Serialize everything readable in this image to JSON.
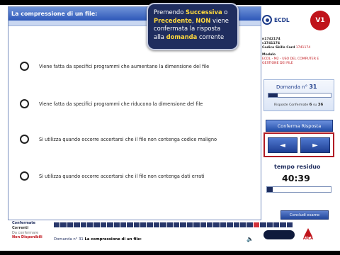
{
  "question": {
    "title": "La compressione di un file:",
    "answers": [
      "Viene fatta da specifici programmi che aumentano la dimensione del file",
      "Viene fatta da specifici programmi che riducono la dimensione del file",
      "Si utilizza quando occorre accertarsi che il file non contenga codice maligno",
      "Si utilizza quando occorre accertarsi che il file non contenga dati errati"
    ]
  },
  "callout": {
    "parts": [
      "Premendo ",
      "Successiva",
      " o ",
      "Precedente",
      ", ",
      "NON",
      " viene confermata la risposta alla ",
      "domanda",
      " corrente"
    ]
  },
  "header": {
    "ecdl_logo": "ECDL",
    "red_logo": "V1"
  },
  "candidate": {
    "id1": "n1742174",
    "id2": "c1741174",
    "skills_card_label": "Codice Skills Card",
    "skills_card_value": "1741174",
    "modulo_label": "Modulo",
    "modulo_value": "ECDL - M2 - USO DEL COMPUTER E GESTIONE DEI FILE"
  },
  "domanda": {
    "label": "Domanda n°",
    "number": "31",
    "progress": 0.15,
    "risposte_label": "Risposte Confermate",
    "risposte_count": "6",
    "risposte_sep": "su",
    "risposte_total": "36"
  },
  "buttons": {
    "conferma": "Conferma Risposta",
    "prev": "◄",
    "next": "►",
    "concludi": "Concludi esame"
  },
  "timer": {
    "label": "tempo residuo",
    "value": "40:39",
    "progress": 0.09
  },
  "legend": {
    "confermate": "Confermate",
    "correnti": "Correnti",
    "da_confermare": "Da confermare",
    "non_disponibili": "Non Disponibili"
  },
  "strip": {
    "total": 36,
    "current": 31,
    "filled_until": 36
  },
  "footer": {
    "label": "Domanda n° 31",
    "question": "La compressione di un file:"
  },
  "aica_logo": "AICA",
  "colors": {
    "header_blue": "#2d57b8",
    "dark_navy": "#1f2d5e",
    "red": "#c0141b",
    "highlight_yellow": "#ffd93d"
  }
}
